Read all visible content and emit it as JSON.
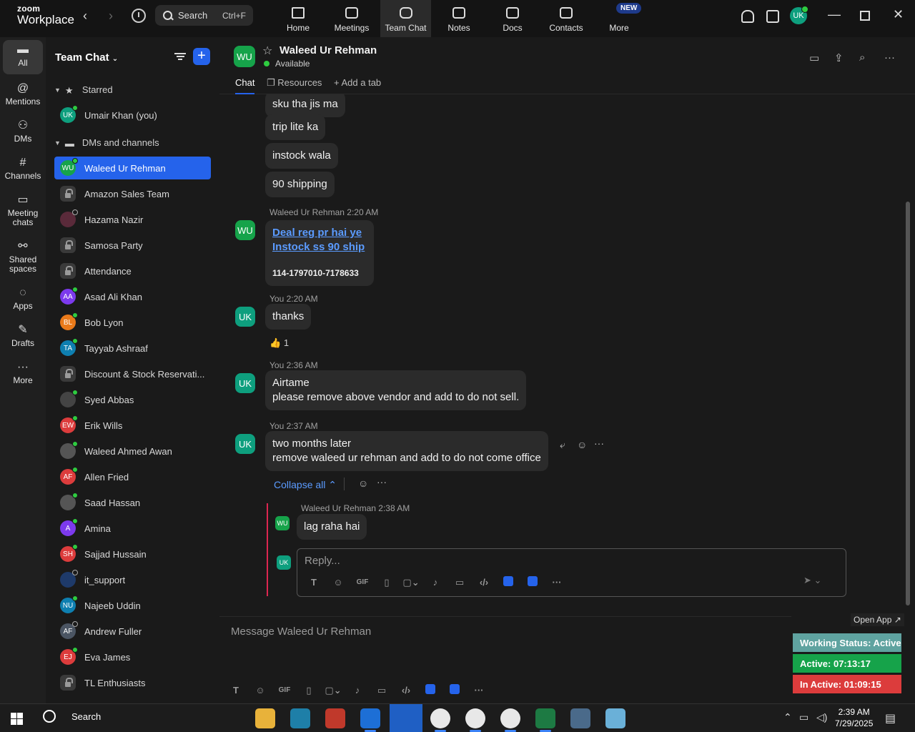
{
  "app": {
    "brand_top": "zoom",
    "brand_bottom": "Workplace"
  },
  "topbar": {
    "search_label": "Search",
    "search_shortcut": "Ctrl+F",
    "tabs": [
      {
        "label": "Home"
      },
      {
        "label": "Meetings"
      },
      {
        "label": "Team Chat"
      },
      {
        "label": "Notes"
      },
      {
        "label": "Docs"
      },
      {
        "label": "Contacts"
      },
      {
        "label": "More"
      }
    ],
    "new_badge": "NEW",
    "user_initials": "UK"
  },
  "rail": {
    "items": [
      {
        "label": "All"
      },
      {
        "label": "Mentions"
      },
      {
        "label": "DMs"
      },
      {
        "label": "Channels"
      },
      {
        "label": "Meeting chats"
      },
      {
        "label": "Shared spaces"
      },
      {
        "label": "Apps"
      },
      {
        "label": "Drafts"
      },
      {
        "label": "More"
      }
    ]
  },
  "sidebar": {
    "title": "Team Chat",
    "starred_label": "Starred",
    "dms_label": "DMs and channels",
    "starred": [
      {
        "initials": "UK",
        "name": "Umair Khan (you)",
        "color": "#0e9f7e"
      }
    ],
    "items": [
      {
        "initials": "WU",
        "name": "Waleed Ur Rehman",
        "color": "#16a34a"
      },
      {
        "initials": "",
        "name": "Amazon Sales Team",
        "color": "#3a3a3a"
      },
      {
        "initials": "",
        "name": "Hazama Nazir",
        "color": "#5a2a3a"
      },
      {
        "initials": "",
        "name": "Samosa Party",
        "color": "#3a3a3a"
      },
      {
        "initials": "",
        "name": "Attendance",
        "color": "#3a3a3a"
      },
      {
        "initials": "AA",
        "name": "Asad Ali Khan",
        "color": "#7c3aed"
      },
      {
        "initials": "BL",
        "name": "Bob Lyon",
        "color": "#ea7a1a"
      },
      {
        "initials": "TA",
        "name": "Tayyab Ashraaf",
        "color": "#0e7fb0"
      },
      {
        "initials": "",
        "name": "Discount & Stock Reservati...",
        "color": "#3a3a3a"
      },
      {
        "initials": "",
        "name": "Syed Abbas",
        "color": "#444"
      },
      {
        "initials": "EW",
        "name": "Erik Wills",
        "color": "#dc3c3c"
      },
      {
        "initials": "",
        "name": "Waleed Ahmed Awan",
        "color": "#555"
      },
      {
        "initials": "AF",
        "name": "Allen Fried",
        "color": "#dc3c3c"
      },
      {
        "initials": "",
        "name": "Saad Hassan",
        "color": "#555"
      },
      {
        "initials": "A",
        "name": "Amina",
        "color": "#7c3aed"
      },
      {
        "initials": "SH",
        "name": "Sajjad Hussain",
        "color": "#dc3c3c"
      },
      {
        "initials": "",
        "name": "it_support",
        "color": "#1e3a6a"
      },
      {
        "initials": "NU",
        "name": "Najeeb Uddin",
        "color": "#0e7fb0"
      },
      {
        "initials": "AF",
        "name": "Andrew Fuller",
        "color": "#4b5563"
      },
      {
        "initials": "EJ",
        "name": "Eva James",
        "color": "#dc3c3c"
      },
      {
        "initials": "",
        "name": "TL Enthusiasts",
        "color": "#3a3a3a"
      }
    ]
  },
  "chat": {
    "initials": "WU",
    "name": "Waleed Ur Rehman",
    "status": "Available",
    "tabs": {
      "chat": "Chat",
      "resources": "Resources",
      "add": "Add a tab"
    },
    "messages": {
      "m1": "sku tha jis ma",
      "m2": "trip lite ka",
      "m3": "instock wala",
      "m4": "90 shipping",
      "m5_meta": "Waleed Ur Rehman 2:20 AM",
      "m5_link1": "Deal reg pr hai ye",
      "m5_link2": "Instock ss 90 ship",
      "m5_order": "114-1797010-7178633",
      "m6_meta": "You 2:20 AM",
      "m6": "thanks",
      "m6_reaction": "1",
      "m7_meta": "You 2:36 AM",
      "m7_l1": "Airtame",
      "m7_l2": "please remove above vendor and add to do not sell.",
      "m8_meta": "You 2:37 AM",
      "m8_l1": "two months later",
      "m8_l2": "remove waleed ur rehman and add to do not come office",
      "collapse": "Collapse all",
      "reply_meta": "Waleed Ur Rehman 2:38 AM",
      "reply": "lag raha hai",
      "reply_placeholder": "Reply..."
    },
    "compose_placeholder": "Message Waleed Ur Rehman"
  },
  "status_widget": {
    "open_app": "Open App ↗",
    "working": "Working Status: Active",
    "active": "Active: 07:13:17",
    "inactive": "In Active: 01:09:15"
  },
  "taskbar": {
    "search": "Search",
    "time": "2:39 AM",
    "date": "7/29/2025"
  }
}
